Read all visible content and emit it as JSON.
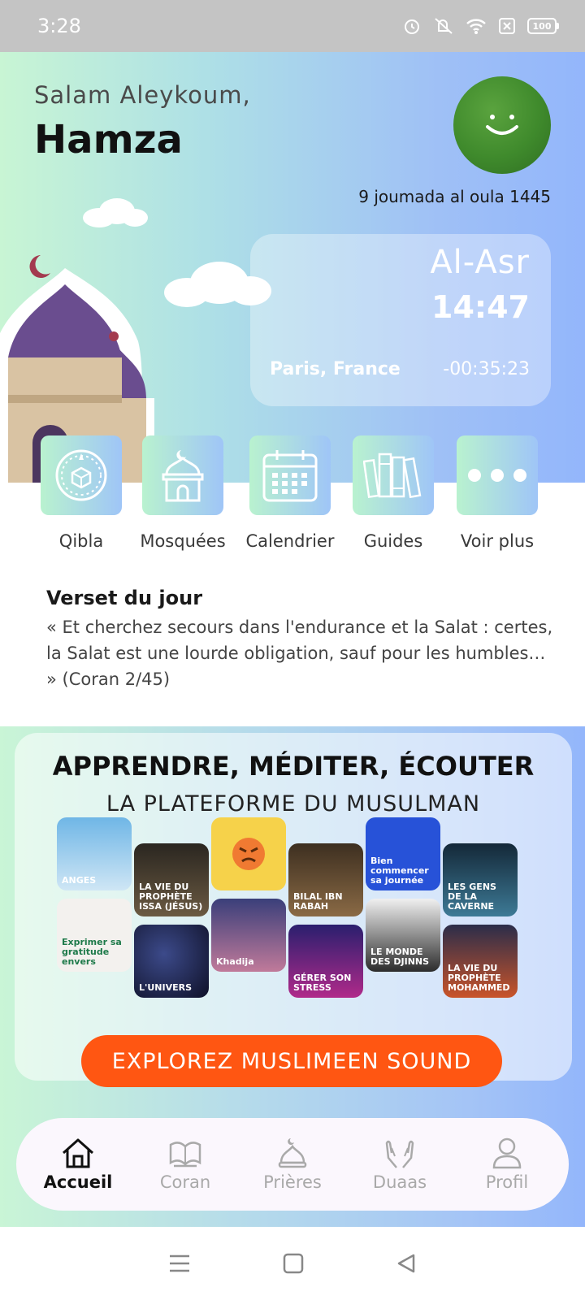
{
  "status_bar": {
    "time": "3:28",
    "battery": "100"
  },
  "header": {
    "greeting": "Salam Aleykoum,",
    "user_name": "Hamza",
    "hijri_date": "9 joumada al oula 1445"
  },
  "prayer_card": {
    "prayer_name": "Al-Asr",
    "prayer_time": "14:47",
    "location": "Paris, France",
    "countdown": "-00:35:23"
  },
  "shortcuts": [
    {
      "label": "Qibla",
      "icon": "compass-kaaba-icon"
    },
    {
      "label": "Mosquées",
      "icon": "mosque-icon"
    },
    {
      "label": "Calendrier",
      "icon": "calendar-icon"
    },
    {
      "label": "Guides",
      "icon": "books-icon"
    },
    {
      "label": "Voir plus",
      "icon": "more-dots-icon"
    }
  ],
  "verse": {
    "title": "Verset du jour",
    "text": "« Et cherchez secours dans l'endurance et la Salat : certes, la Salat est une lourde obligation, sauf pour les humbles… » (Coran 2/45)"
  },
  "promo": {
    "title": "APPRENDRE, MÉDITER, ÉCOUTER",
    "subtitle": "LA PLATEFORME DU MUSULMAN",
    "button_label": "EXPLOREZ MUSLIMEEN SOUND",
    "thumbnails": [
      {
        "label": "ANGES",
        "color": "#6fb6e6"
      },
      {
        "label": "LA VIE DU PROPHÈTE ISSA (JÉSUS)",
        "color": "#3a3328"
      },
      {
        "label": "",
        "color": "#f6d24a"
      },
      {
        "label": "BILAL IBN RABAH",
        "color": "#5a4630"
      },
      {
        "label": "Bien commencer sa journée",
        "color": "#2752d8"
      },
      {
        "label": "LES GENS DE LA CAVERNE",
        "color": "#1f3d55"
      },
      {
        "label": "Exprimer sa gratitude envers",
        "color": "#f3f1ee"
      },
      {
        "label": "L'UNIVERS",
        "color": "#1b2040"
      },
      {
        "label": "Khadija",
        "color": "#3a3f7a"
      },
      {
        "label": "GÉRER SON STRESS",
        "color": "#2a1f6e"
      },
      {
        "label": "LE MONDE DES DJINNS",
        "color": "#2c2c2c"
      },
      {
        "label": "LA VIE DU PROPHÈTE MOHAMMED",
        "color": "#2b2d4a"
      }
    ]
  },
  "bottom_nav": [
    {
      "label": "Accueil",
      "icon": "home-icon",
      "active": true
    },
    {
      "label": "Coran",
      "icon": "quran-book-icon",
      "active": false
    },
    {
      "label": "Prières",
      "icon": "dome-icon",
      "active": false
    },
    {
      "label": "Duaas",
      "icon": "praying-hands-icon",
      "active": false
    },
    {
      "label": "Profil",
      "icon": "user-icon",
      "active": false
    }
  ]
}
